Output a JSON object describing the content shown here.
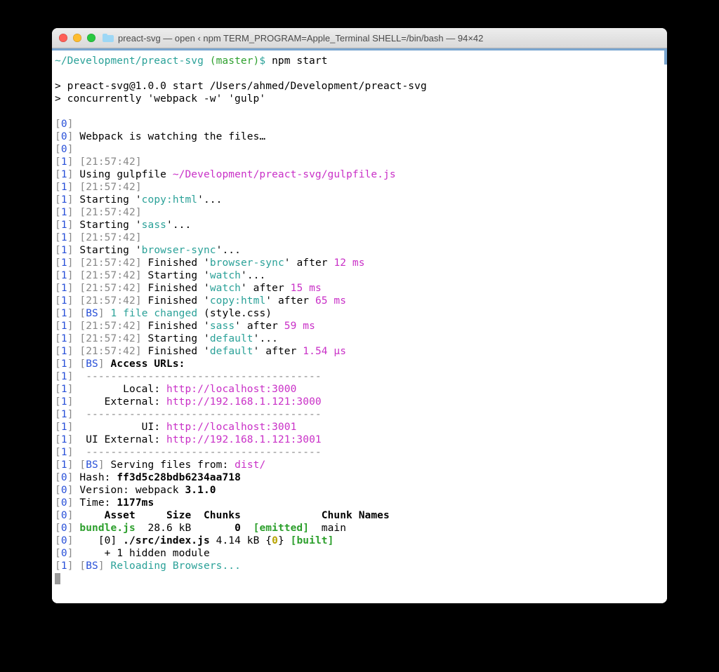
{
  "titlebar": {
    "title": "preact-svg — open ‹ npm TERM_PROGRAM=Apple_Terminal SHELL=/bin/bash — 94×42"
  },
  "prompt": {
    "path": "~/Development/preact-svg ",
    "branch": "(master)",
    "sep": "$ ",
    "command": "npm start"
  },
  "npm": {
    "line1": "> preact-svg@1.0.0 start /Users/ahmed/Development/preact-svg",
    "line2": "> concurrently 'webpack -w' 'gulp'"
  },
  "prefix": {
    "open": "[",
    "close": "] ",
    "p0": "0",
    "p1": "1"
  },
  "out": {
    "webpack_watch": "Webpack is watching the files…",
    "ts": "[21:57:42]",
    "gulpfile_pre": "Using gulpfile ",
    "gulpfile_path": "~/Development/preact-svg/gulpfile.js",
    "starting": "Starting '",
    "finished": "Finished '",
    "after": "' after ",
    "close_dots": "'...",
    "task_copyhtml": "copy:html",
    "task_sass": "sass",
    "task_browsersync": "browser-sync",
    "task_watch": "watch",
    "task_default": "default",
    "t12ms": "12 ms",
    "t15ms": "15 ms",
    "t65ms": "65 ms",
    "t59ms": "59 ms",
    "t154us": "1.54 μs",
    "bs_open": "[",
    "bs_label": "BS",
    "bs_close": "] ",
    "file_changed_pre": "1 file changed",
    "file_changed_paren": " (style.css)",
    "access_urls": "Access URLs:",
    "divider": " --------------------------------------",
    "local_label": "       Local: ",
    "external_label": "    External: ",
    "ui_label": "          UI: ",
    "ui_external_label": " UI External: ",
    "local_url": "http://localhost:3000",
    "external_url": "http://192.168.1.121:3000",
    "ui_url": "http://localhost:3001",
    "ui_external_url": "http://192.168.1.121:3001",
    "serving_pre": "Serving files from: ",
    "serving_path": "dist/",
    "hash_label": "Hash: ",
    "hash_value": "ff3d5c28bdb6234aa718",
    "version_label": "Version: webpack ",
    "version_value": "3.1.0",
    "time_label": "Time: ",
    "time_value": "1177ms",
    "table_header": "    Asset     Size  Chunks             Chunk Names",
    "bundle_name": "bundle.js",
    "bundle_rest": "  28.6 kB       ",
    "bundle_zero": "0",
    "bundle_sp": "  ",
    "emitted": "[emitted]",
    "bundle_main": "  main",
    "built_line_pre": "   [0] ",
    "built_file": "./src/index.js",
    "built_mid": " 4.14 kB {",
    "built_zero": "0",
    "built_brace": "} ",
    "built_tag": "[built]",
    "hidden": "    + 1 hidden module",
    "reloading": "Reloading Browsers..."
  }
}
